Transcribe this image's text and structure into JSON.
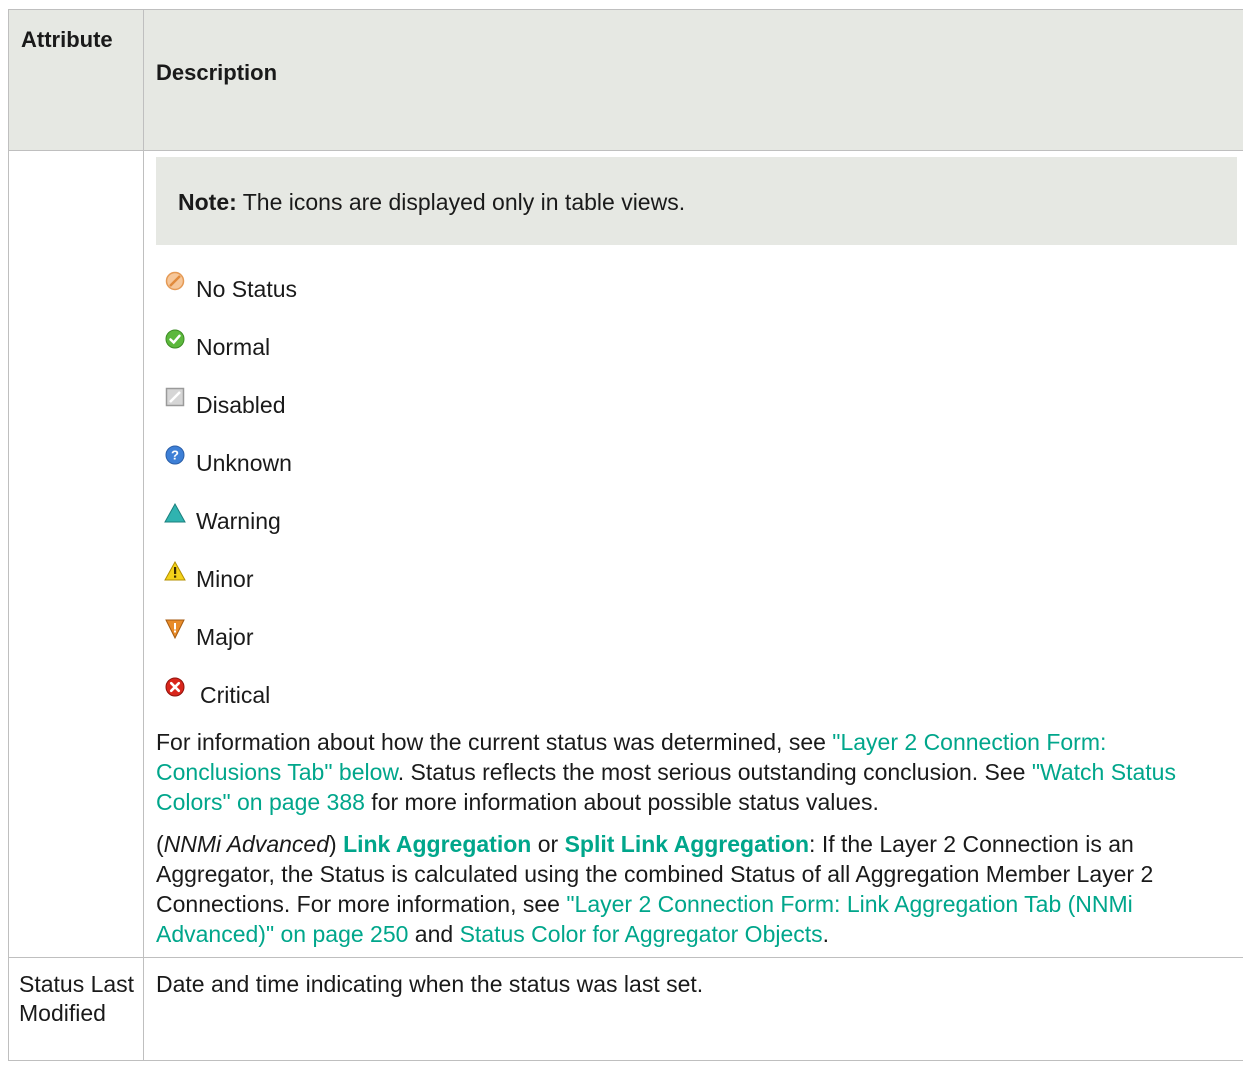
{
  "table": {
    "header": {
      "attribute": "Attribute",
      "description": "Description"
    },
    "note": {
      "label": "Note:",
      "text": " The icons are displayed only in table views."
    },
    "statuses": [
      {
        "label": "No Status",
        "icon": "no-status-icon",
        "color": "#f0a868"
      },
      {
        "label": "Normal",
        "icon": "normal-icon",
        "color": "#5cb83c"
      },
      {
        "label": "Disabled",
        "icon": "disabled-icon",
        "color": "#b9b9b9"
      },
      {
        "label": "Unknown",
        "icon": "unknown-icon",
        "color": "#3d7fd6"
      },
      {
        "label": "Warning",
        "icon": "warning-icon",
        "color": "#2fb3b0"
      },
      {
        "label": "Minor",
        "icon": "minor-icon",
        "color": "#f3d21a"
      },
      {
        "label": "Major",
        "icon": "major-icon",
        "color": "#e88c2a"
      },
      {
        "label": "Critical",
        "icon": "critical-icon",
        "color": "#d9261c"
      }
    ],
    "para1": {
      "t1": "For information about how the current status was determined, see ",
      "link1": "\"Layer 2 Connection Form: Conclusions Tab\" below",
      "t2": ". Status reflects the most serious outstanding conclusion. See ",
      "link2": "\"Watch Status Colors\" on page 388",
      "t3": " for more information about possible status values."
    },
    "para2": {
      "open_paren": "(",
      "italic": "NNMi Advanced",
      "close_paren": ") ",
      "bold1": "Link Aggregation",
      "or": " or ",
      "bold2": "Split Link Aggregation",
      "t1": ": If the Layer 2 Connection is an Aggregator, the Status is calculated using the combined Status of all Aggregation Member Layer 2 Connections. For more information, see ",
      "link1": "\"Layer 2 Connection Form: Link Aggregation Tab (NNMi Advanced)\" on page 250",
      "and": " and ",
      "link2": "Status Color for Aggregator Objects",
      "end": "."
    },
    "row2": {
      "attribute": "Status Last Modified",
      "description": "Date and time indicating when the status was last set."
    },
    "colors": {
      "header_bg": "#e6e8e3",
      "link": "#00a68b",
      "border": "#bfbfbf"
    }
  }
}
